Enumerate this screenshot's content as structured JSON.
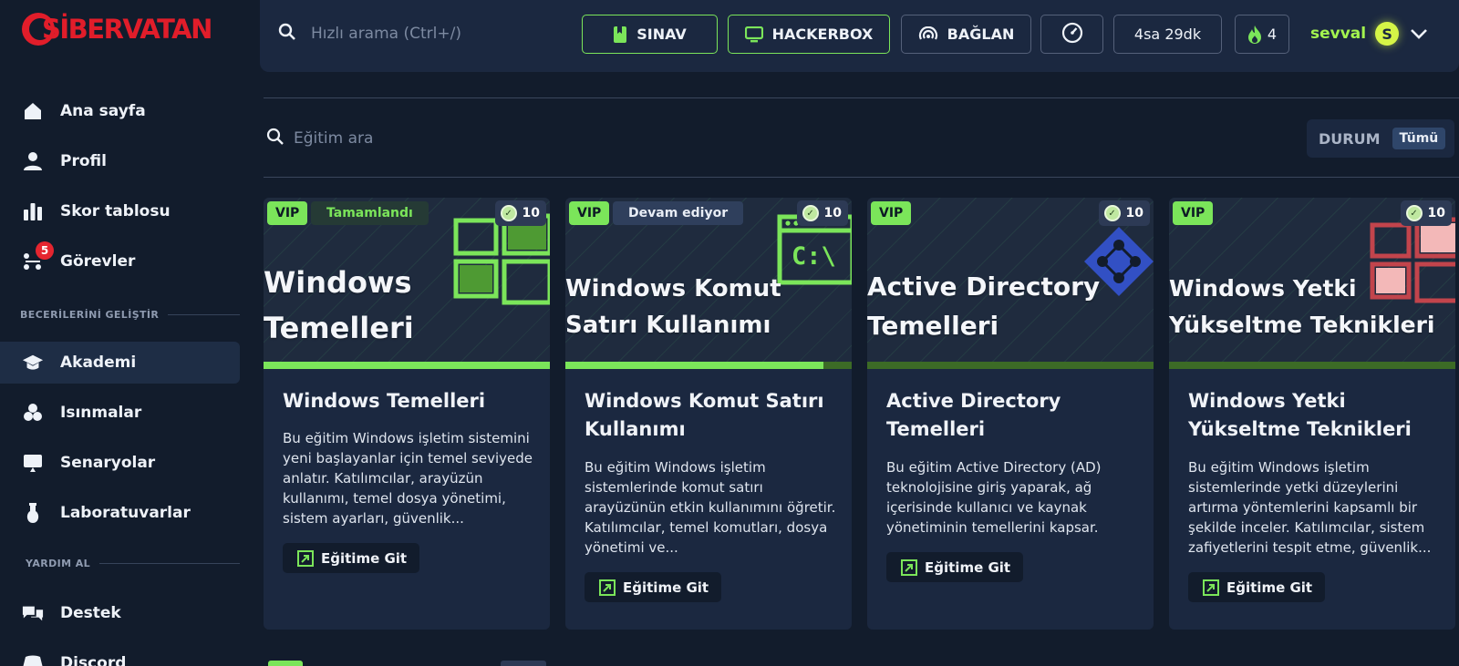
{
  "brand": {
    "logo_text": "SİBERVATAN",
    "color": "#e11d2a"
  },
  "colors": {
    "accent": "#7be55a",
    "background": "#121c2c",
    "panel": "#1b2840",
    "user": "#a3f44f"
  },
  "sidebar": {
    "items": [
      {
        "label": "Ana sayfa",
        "icon": "home-icon"
      },
      {
        "label": "Profil",
        "icon": "user-icon"
      },
      {
        "label": "Skor tablosu",
        "icon": "bar-chart-icon"
      },
      {
        "label": "Görevler",
        "icon": "tasks-icon",
        "badge": "5"
      },
      {
        "label": "Akademi",
        "icon": "graduation-cap-icon",
        "active": true
      },
      {
        "label": "Isınmalar",
        "icon": "warmup-icon"
      },
      {
        "label": "Senaryolar",
        "icon": "scenario-icon"
      },
      {
        "label": "Laboratuvarlar",
        "icon": "flask-icon"
      },
      {
        "label": "Destek",
        "icon": "chat-icon"
      },
      {
        "label": "Discord",
        "icon": "discord-icon"
      }
    ],
    "sections": {
      "skills": "BECERİLERİNİ GELİŞTİR",
      "help": "YARDIM AL"
    }
  },
  "topbar": {
    "search_placeholder": "Hızlı arama (Ctrl+/)",
    "buttons": {
      "exam": "SINAV",
      "hackerbox": "HACKERBOX",
      "connect": "BAĞLAN",
      "timer": "4sa 29dk",
      "streak": "4"
    },
    "user": {
      "name": "sevval",
      "avatar_letter": "S"
    }
  },
  "filters": {
    "search_placeholder": "Eğitim ara",
    "status_label": "DURUM",
    "status_value": "Tümü"
  },
  "cards": [
    {
      "vip": "VIP",
      "status": "Tamamlandı",
      "points": "10",
      "banner_title": "Windows Temelleri",
      "title": "Windows Temelleri",
      "description": "Bu eğitim Windows işletim sistemini yeni başlayanlar için temel seviyede anlatır. Katılımcılar, arayüzün kullanımı, temel dosya yönetimi, sistem ayarları, güvenlik...",
      "button": "Eğitime Git",
      "progress": 1.0
    },
    {
      "vip": "VIP",
      "status": "Devam ediyor",
      "points": "10",
      "banner_title": "Windows Komut Satırı Kullanımı",
      "title": "Windows Komut Satırı Kullanımı",
      "description": "Bu eğitim Windows işletim sistemlerinde komut satırı arayüzünün etkin kullanımını öğretir. Katılımcılar, temel komutları, dosya yönetimi ve...",
      "button": "Eğitime Git",
      "progress": 0.9
    },
    {
      "vip": "VIP",
      "points": "10",
      "banner_title": "Active Directory Temelleri",
      "title": "Active Directory Temelleri",
      "description": "Bu eğitim Active Directory (AD) teknolojisine giriş yaparak, ağ içerisinde kullanıcı ve kaynak yönetiminin temellerini kapsar.",
      "button": "Eğitime Git",
      "progress": 0
    },
    {
      "vip": "VIP",
      "points": "10",
      "banner_title": "Windows Yetki Yükseltme Teknikleri",
      "title": "Windows Yetki Yükseltme Teknikleri",
      "description": "Bu eğitim Windows işletim sistemlerinde yetki düzeylerini artırma yöntemlerini kapsamlı bir şekilde inceler. Katılımcılar, sistem zafiyetlerini tespit etme, güvenlik...",
      "button": "Eğitime Git",
      "progress": 0
    }
  ]
}
